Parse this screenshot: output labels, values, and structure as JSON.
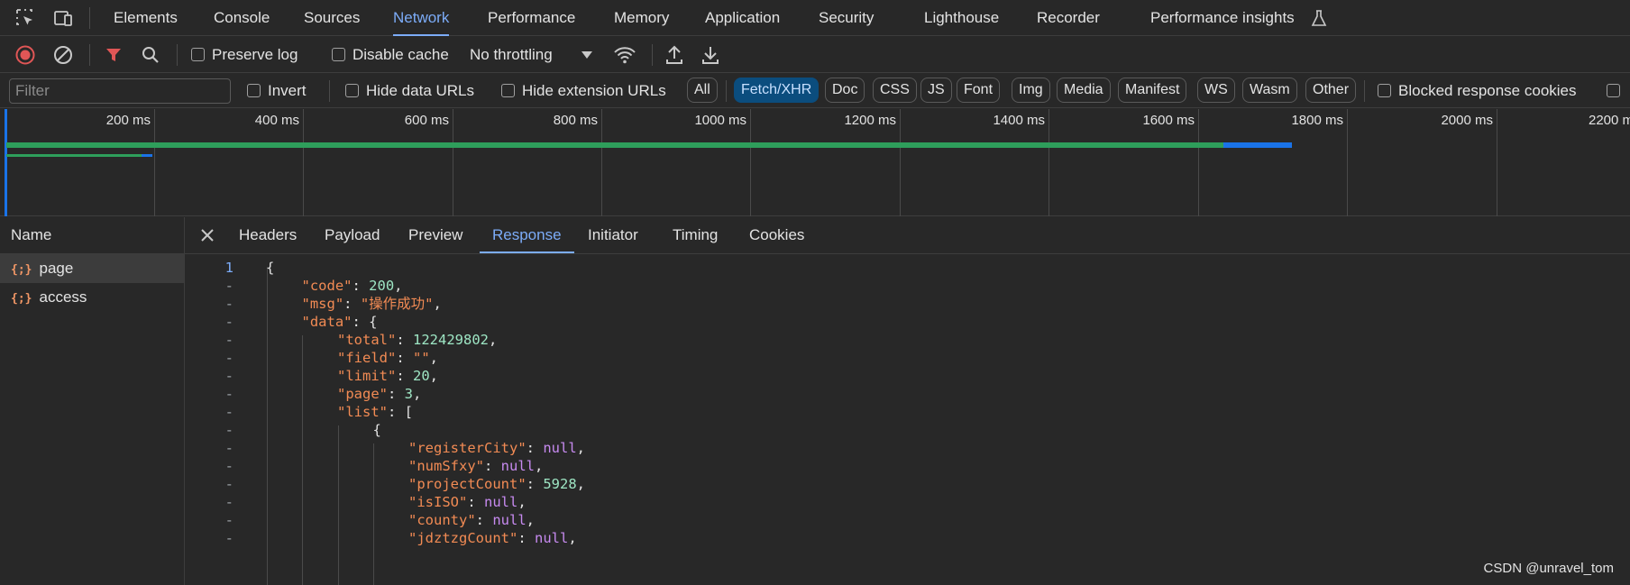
{
  "devtools_tabs": [
    "Elements",
    "Console",
    "Sources",
    "Network",
    "Performance",
    "Memory",
    "Application",
    "Security",
    "Lighthouse",
    "Recorder",
    "Performance insights"
  ],
  "active_tab": "Network",
  "toolbar": {
    "preserve_log": "Preserve log",
    "disable_cache": "Disable cache",
    "throttling": "No throttling"
  },
  "filterbar": {
    "filter_placeholder": "Filter",
    "invert": "Invert",
    "hide_data_urls": "Hide data URLs",
    "hide_extension_urls": "Hide extension URLs",
    "types": [
      "All",
      "Fetch/XHR",
      "Doc",
      "CSS",
      "JS",
      "Font",
      "Img",
      "Media",
      "Manifest",
      "WS",
      "Wasm",
      "Other"
    ],
    "active_type": "Fetch/XHR",
    "blocked_cookies": "Blocked response cookies"
  },
  "overview": {
    "ticks": [
      "200 ms",
      "400 ms",
      "600 ms",
      "800 ms",
      "1000 ms",
      "1200 ms",
      "1400 ms",
      "1600 ms",
      "1800 ms",
      "2000 ms",
      "2200 ms"
    ]
  },
  "requests": {
    "header": "Name",
    "items": [
      {
        "icon": "{;}",
        "name": "page"
      },
      {
        "icon": "{;}",
        "name": "access"
      }
    ]
  },
  "detail_tabs": [
    "Headers",
    "Payload",
    "Preview",
    "Response",
    "Initiator",
    "Timing",
    "Cookies"
  ],
  "active_detail_tab": "Response",
  "response_lines": [
    {
      "g": "1",
      "t": "{"
    },
    {
      "g": "-",
      "t": "\"code\": 200,"
    },
    {
      "g": "-",
      "t": "\"msg\": \"操作成功\","
    },
    {
      "g": "-",
      "t": "\"data\": {"
    },
    {
      "g": "-",
      "t": "\"total\": 122429802,"
    },
    {
      "g": "-",
      "t": "\"field\": \"\","
    },
    {
      "g": "-",
      "t": "\"limit\": 20,"
    },
    {
      "g": "-",
      "t": "\"page\": 3,"
    },
    {
      "g": "-",
      "t": "\"list\": ["
    },
    {
      "g": "-",
      "t": "{"
    },
    {
      "g": "-",
      "t": "\"registerCity\": null,"
    },
    {
      "g": "-",
      "t": "\"numSfxy\": null,"
    },
    {
      "g": "-",
      "t": "\"projectCount\": 5928,"
    },
    {
      "g": "-",
      "t": "\"isISO\": null,"
    },
    {
      "g": "-",
      "t": "\"county\": null,"
    },
    {
      "g": "-",
      "t": "\"jdztzgCount\": null,"
    }
  ],
  "watermark": "CSDN @unravel_tom",
  "colors": {
    "accent": "#7cacf8",
    "key": "#f28b54",
    "number": "#9ee6c4",
    "null": "#c78af0",
    "bar_green": "#2e9e5b",
    "bar_blue": "#1a73e8",
    "record_red": "#e05656"
  }
}
